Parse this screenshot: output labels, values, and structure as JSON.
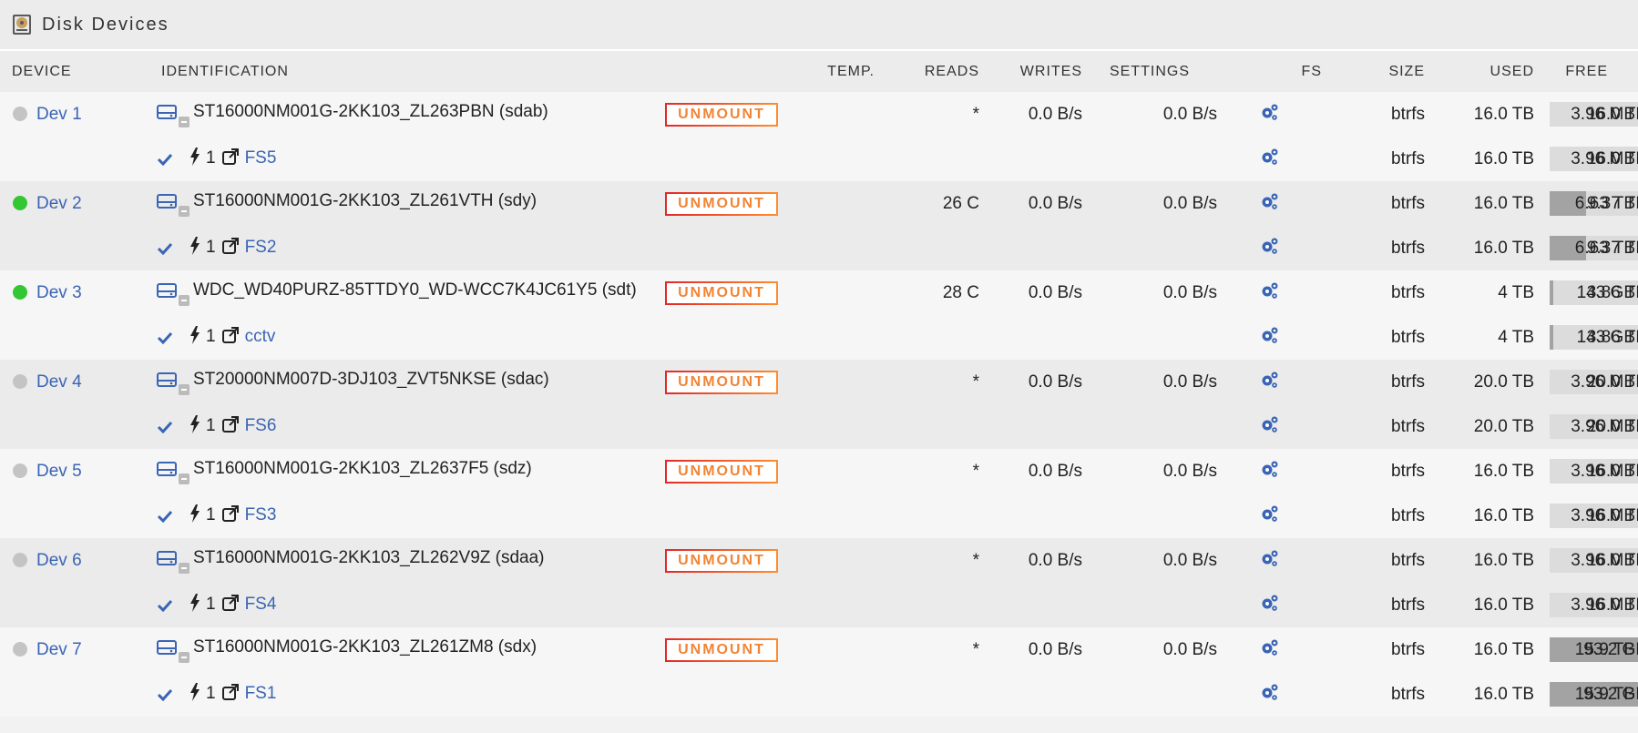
{
  "header": {
    "title": "Disk Devices"
  },
  "columns": {
    "device": "Device",
    "identification": "Identification",
    "temp": "Temp.",
    "reads": "Reads",
    "writes": "Writes",
    "settings": "Settings",
    "fs": "FS",
    "size": "Size",
    "used": "Used",
    "free": "Free"
  },
  "colors": {
    "active": "#33c833",
    "standby": "#c4c4c4",
    "link": "#3a64b4",
    "accent": "#f28434"
  },
  "devices": [
    {
      "name": "Dev 1",
      "status": "standby",
      "id": "ST16000NM001G-2KK103_ZL263PBN (sdab)",
      "action": "UNMOUNT",
      "temp": "*",
      "reads": "0.0 B/s",
      "writes": "0.0 B/s",
      "fs": "btrfs",
      "size": "16.0 TB",
      "used": "3.96 MB",
      "free": "16.0 TB",
      "used_frac": 0.0,
      "free_frac": 1.0,
      "part": {
        "slot": "1",
        "label": "FS5",
        "fs": "btrfs",
        "size": "16.0 TB",
        "used": "3.96 MB",
        "free": "16.0 TB",
        "used_frac": 0.0,
        "free_frac": 1.0
      }
    },
    {
      "name": "Dev 2",
      "status": "active",
      "id": "ST16000NM001G-2KK103_ZL261VTH (sdy)",
      "action": "UNMOUNT",
      "temp": "26 C",
      "reads": "0.0 B/s",
      "writes": "0.0 B/s",
      "fs": "btrfs",
      "size": "16.0 TB",
      "used": "6.63 TB",
      "free": "9.37 TB",
      "used_frac": 0.41,
      "free_frac": 0.59,
      "part": {
        "slot": "1",
        "label": "FS2",
        "fs": "btrfs",
        "size": "16.0 TB",
        "used": "6.63 TB",
        "free": "9.37 TB",
        "used_frac": 0.41,
        "free_frac": 0.59
      }
    },
    {
      "name": "Dev 3",
      "status": "active",
      "id": "WDC_WD40PURZ-85TTDY0_WD-WCC7K4JC61Y5 (sdt)",
      "action": "UNMOUNT",
      "temp": "28 C",
      "reads": "0.0 B/s",
      "writes": "0.0 B/s",
      "fs": "btrfs",
      "size": "4 TB",
      "used": "143 GB",
      "free": "3.86 TB",
      "used_frac": 0.04,
      "free_frac": 0.96,
      "part": {
        "slot": "1",
        "label": "cctv",
        "fs": "btrfs",
        "size": "4 TB",
        "used": "143 GB",
        "free": "3.86 TB",
        "used_frac": 0.04,
        "free_frac": 0.96
      }
    },
    {
      "name": "Dev 4",
      "status": "standby",
      "id": "ST20000NM007D-3DJ103_ZVT5NKSE (sdac)",
      "action": "UNMOUNT",
      "temp": "*",
      "reads": "0.0 B/s",
      "writes": "0.0 B/s",
      "fs": "btrfs",
      "size": "20.0 TB",
      "used": "3.96 MB",
      "free": "20.0 TB",
      "used_frac": 0.0,
      "free_frac": 1.0,
      "part": {
        "slot": "1",
        "label": "FS6",
        "fs": "btrfs",
        "size": "20.0 TB",
        "used": "3.96 MB",
        "free": "20.0 TB",
        "used_frac": 0.0,
        "free_frac": 1.0
      }
    },
    {
      "name": "Dev 5",
      "status": "standby",
      "id": "ST16000NM001G-2KK103_ZL2637F5 (sdz)",
      "action": "UNMOUNT",
      "temp": "*",
      "reads": "0.0 B/s",
      "writes": "0.0 B/s",
      "fs": "btrfs",
      "size": "16.0 TB",
      "used": "3.96 MB",
      "free": "16.0 TB",
      "used_frac": 0.0,
      "free_frac": 1.0,
      "part": {
        "slot": "1",
        "label": "FS3",
        "fs": "btrfs",
        "size": "16.0 TB",
        "used": "3.96 MB",
        "free": "16.0 TB",
        "used_frac": 0.0,
        "free_frac": 1.0
      }
    },
    {
      "name": "Dev 6",
      "status": "standby",
      "id": "ST16000NM001G-2KK103_ZL262V9Z (sdaa)",
      "action": "UNMOUNT",
      "temp": "*",
      "reads": "0.0 B/s",
      "writes": "0.0 B/s",
      "fs": "btrfs",
      "size": "16.0 TB",
      "used": "3.96 MB",
      "free": "16.0 TB",
      "used_frac": 0.0,
      "free_frac": 1.0,
      "part": {
        "slot": "1",
        "label": "FS4",
        "fs": "btrfs",
        "size": "16.0 TB",
        "used": "3.96 MB",
        "free": "16.0 TB",
        "used_frac": 0.0,
        "free_frac": 1.0
      }
    },
    {
      "name": "Dev 7",
      "status": "standby",
      "id": "ST16000NM001G-2KK103_ZL261ZM8 (sdx)",
      "action": "UNMOUNT",
      "temp": "*",
      "reads": "0.0 B/s",
      "writes": "0.0 B/s",
      "fs": "btrfs",
      "size": "16.0 TB",
      "used": "15.9 TB",
      "free": "93.2 GB",
      "used_frac": 1.0,
      "free_frac": 0.01,
      "part": {
        "slot": "1",
        "label": "FS1",
        "fs": "btrfs",
        "size": "16.0 TB",
        "used": "15.9 TB",
        "free": "93.2 GB",
        "used_frac": 1.0,
        "free_frac": 0.01
      }
    }
  ]
}
